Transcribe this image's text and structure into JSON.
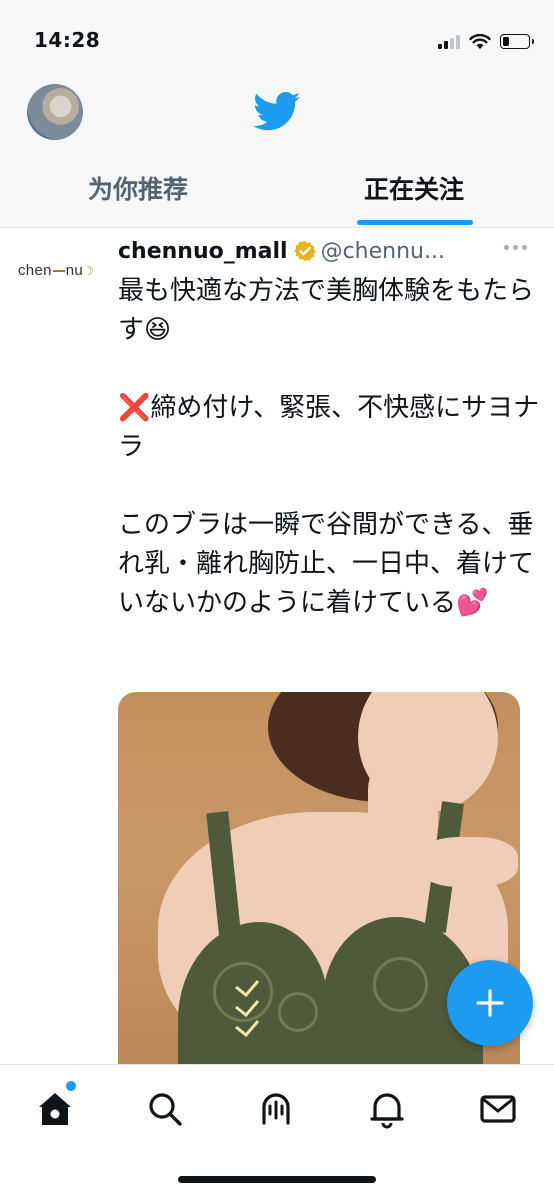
{
  "status_bar": {
    "time": "14:28",
    "icons": [
      "cellular-signal-icon",
      "wifi-icon",
      "battery-icon"
    ],
    "battery_level": 0.25
  },
  "header": {
    "logo_icon": "twitter-bird-icon",
    "tabs": [
      {
        "label": "为你推荐",
        "active": false
      },
      {
        "label": "正在关注",
        "active": true
      }
    ]
  },
  "tweet": {
    "avatar_text": "chen",
    "avatar_text_end": "nu",
    "display_name": "chennuo_mall",
    "handle": "@chennu...",
    "text": "最も快適な方法で美胸体験をもたらす😆\n\n❌締め付け、緊張、不快感にサヨナラ\n\nこのブラは一瞬で谷間ができる、垂れ乳・離れ胸防止、一日中、着けていないかのように着けている💕"
  },
  "fab": {
    "icon": "compose-plus-icon"
  },
  "bottom_nav": {
    "items": [
      "home-icon",
      "search-icon",
      "spaces-icon",
      "notifications-icon",
      "messages-icon"
    ]
  },
  "colors": {
    "accent": "#1d9bf0",
    "text_primary": "#0f1419",
    "text_secondary": "#536471"
  }
}
